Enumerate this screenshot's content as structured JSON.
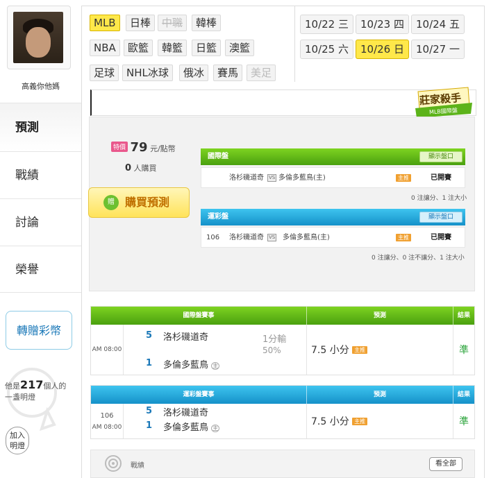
{
  "user": {
    "name": "高義你他媽"
  },
  "nav": {
    "items": [
      "預測",
      "戰績",
      "討論",
      "榮譽"
    ]
  },
  "gift_button": "轉贈彩幣",
  "bulb": {
    "prefix": "他是",
    "count": "217",
    "suffix": "個人的",
    "line2": "一盞明燈"
  },
  "join_button": {
    "line1": "加入",
    "line2": "明燈"
  },
  "leagues": [
    "MLB",
    "日棒",
    "中職",
    "韓棒",
    "NBA",
    "歐籃",
    "韓籃",
    "日籃",
    "澳籃",
    "足球",
    "NHL冰球",
    "俄冰",
    "賽馬",
    "美足"
  ],
  "dates": [
    "10/22 三",
    "10/23 四",
    "10/24 五",
    "10/25 六",
    "10/26 日",
    "10/27 一"
  ],
  "badge": {
    "title": "莊家殺手",
    "sub": "MLB國際盤"
  },
  "purchase": {
    "tag": "特價",
    "price": "79",
    "unit": "元/點幣",
    "buyers": "0",
    "buyers_suffix": "人購買",
    "buy_button": "購買預測",
    "coin_icon": "贈"
  },
  "intl_panel": {
    "title": "國際盤",
    "show_button": "顯示盤口",
    "away": "洛杉磯道奇",
    "vs": "VS",
    "home": "多倫多藍鳥(主)",
    "pick_tag": "主推",
    "status": "已開賽",
    "note": "0 注讓分、1 注大小"
  },
  "lottery_panel": {
    "title": "運彩盤",
    "show_button": "顯示盤口",
    "game_no": "106",
    "away": "洛杉磯道奇",
    "vs": "VS",
    "home": "多倫多藍鳥(主)",
    "pick_tag": "主推",
    "status": "已開賽",
    "note": "0 注讓分、0 注不讓分、1 注大小"
  },
  "intl_table": {
    "headers": [
      "國際盤賽事",
      "預測",
      "結果"
    ],
    "time": "AM 08:00",
    "away_score": "5",
    "away": "洛杉磯道奇",
    "home_score": "1",
    "home": "多倫多藍鳥",
    "home_mark": "主",
    "line1": "1分輸",
    "line2": "50%",
    "prediction": "7.5 小分",
    "pick_tag": "主推",
    "result": "準"
  },
  "lottery_table": {
    "headers": [
      "運彩盤賽事",
      "預測",
      "結果"
    ],
    "game_no": "106",
    "time": "AM 08:00",
    "away_score": "5",
    "away": "洛杉磯道奇",
    "home_score": "1",
    "home": "多倫多藍鳥",
    "home_mark": "主",
    "prediction": "7.5 小分",
    "pick_tag": "主推",
    "result": "準"
  },
  "footer": {
    "label": "戰績",
    "view_all": "看全部"
  }
}
